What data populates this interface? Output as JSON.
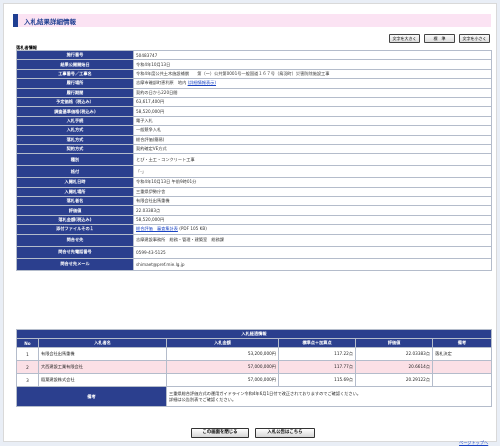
{
  "page": {
    "title": "入札結果詳細情報",
    "section_label": "落札者情報"
  },
  "font_buttons": {
    "large": "文字を大きく",
    "standard": "標　準",
    "small": "文字を小さく"
  },
  "info_rows": [
    {
      "label": "施行番号",
      "value": "50483747"
    },
    {
      "label": "結果公開開始日",
      "value": "令和4年10月13日"
    },
    {
      "label": "工事番号／工事名",
      "value": "令和4年度公共土木施設補償　　第（〜）公共第0001号一般国道１６７号（鳥羽町）災害防除施設工事"
    },
    {
      "label": "履行場所",
      "value": "志摩市磯部町恵利原　地内",
      "link": "(詳細情報表示)"
    },
    {
      "label": "履行期間",
      "value": "契約の日から220日間"
    },
    {
      "label": "予定価格（税込み）",
      "value": "63,617,400円"
    },
    {
      "label": "調査基準価格(税込み)",
      "value": "58,520,000円"
    },
    {
      "label": "入札手続",
      "value": "電子入札"
    },
    {
      "label": "入札方式",
      "value": "一般競争入札"
    },
    {
      "label": "落札方式",
      "value": "総合評価(簡易)"
    },
    {
      "label": "契約方式",
      "value": "契約確定VE方式"
    },
    {
      "label": "種別",
      "value": "とび・土工・コンクリート工事"
    },
    {
      "label": "格付",
      "value": "「-」"
    },
    {
      "label": "入開札日時",
      "value": "令和4年10月13日 午前9時01分"
    },
    {
      "label": "入開札場所",
      "value": "三重県伊勢庁舎"
    },
    {
      "label": "落札者名",
      "value": "有限会社出馬重機"
    },
    {
      "label": "評価値",
      "value": "22.03383点"
    },
    {
      "label": "落札金額(税込み)",
      "value": "58,520,000円"
    },
    {
      "label": "添付ファイルその１",
      "value": "",
      "link": "総合評価　審査集計表",
      "suffix": "(PDF 105 KB)"
    },
    {
      "label": "問合せ先",
      "value": "志摩建設事務所　総務・管理・建築室　総務課"
    },
    {
      "label": "問合せ先電話番号",
      "value": "0599-43-5125"
    },
    {
      "label": "問合せ先メール",
      "value": "shimaet@pref.mie.lg.jp"
    }
  ],
  "results": {
    "caption": "入札経過情報",
    "headers": [
      "No",
      "入札者名",
      "入札金額",
      "標準点＋加算点",
      "評価値",
      "備考"
    ],
    "rows": [
      {
        "no": "1",
        "name": "有限会社出馬重機",
        "amount": "53,200,000円",
        "points": "117.22点",
        "score": "22.03383点",
        "remark": "落札決定",
        "highlight": false
      },
      {
        "no": "2",
        "name": "大西建設工業有限会社",
        "amount": "57,000,000円",
        "points": "117.77点",
        "score": "20.6614点",
        "remark": "",
        "highlight": true
      },
      {
        "no": "3",
        "name": "稲葉建設株式会社",
        "amount": "57,000,000円",
        "points": "115.69点",
        "score": "20.29122点",
        "remark": "",
        "highlight": false
      }
    ],
    "note_label": "備考",
    "note_line1": "三重県総合評価方式の運用ガイドライン令和4年6月1日付で改正されておりますのでご確認ください。",
    "note_line2": "詳細は公告別表でご確認ください。"
  },
  "bottom": {
    "close": "この画面を閉じる",
    "notice": "入札公告はこちら",
    "page_top": "ページトップへ"
  }
}
